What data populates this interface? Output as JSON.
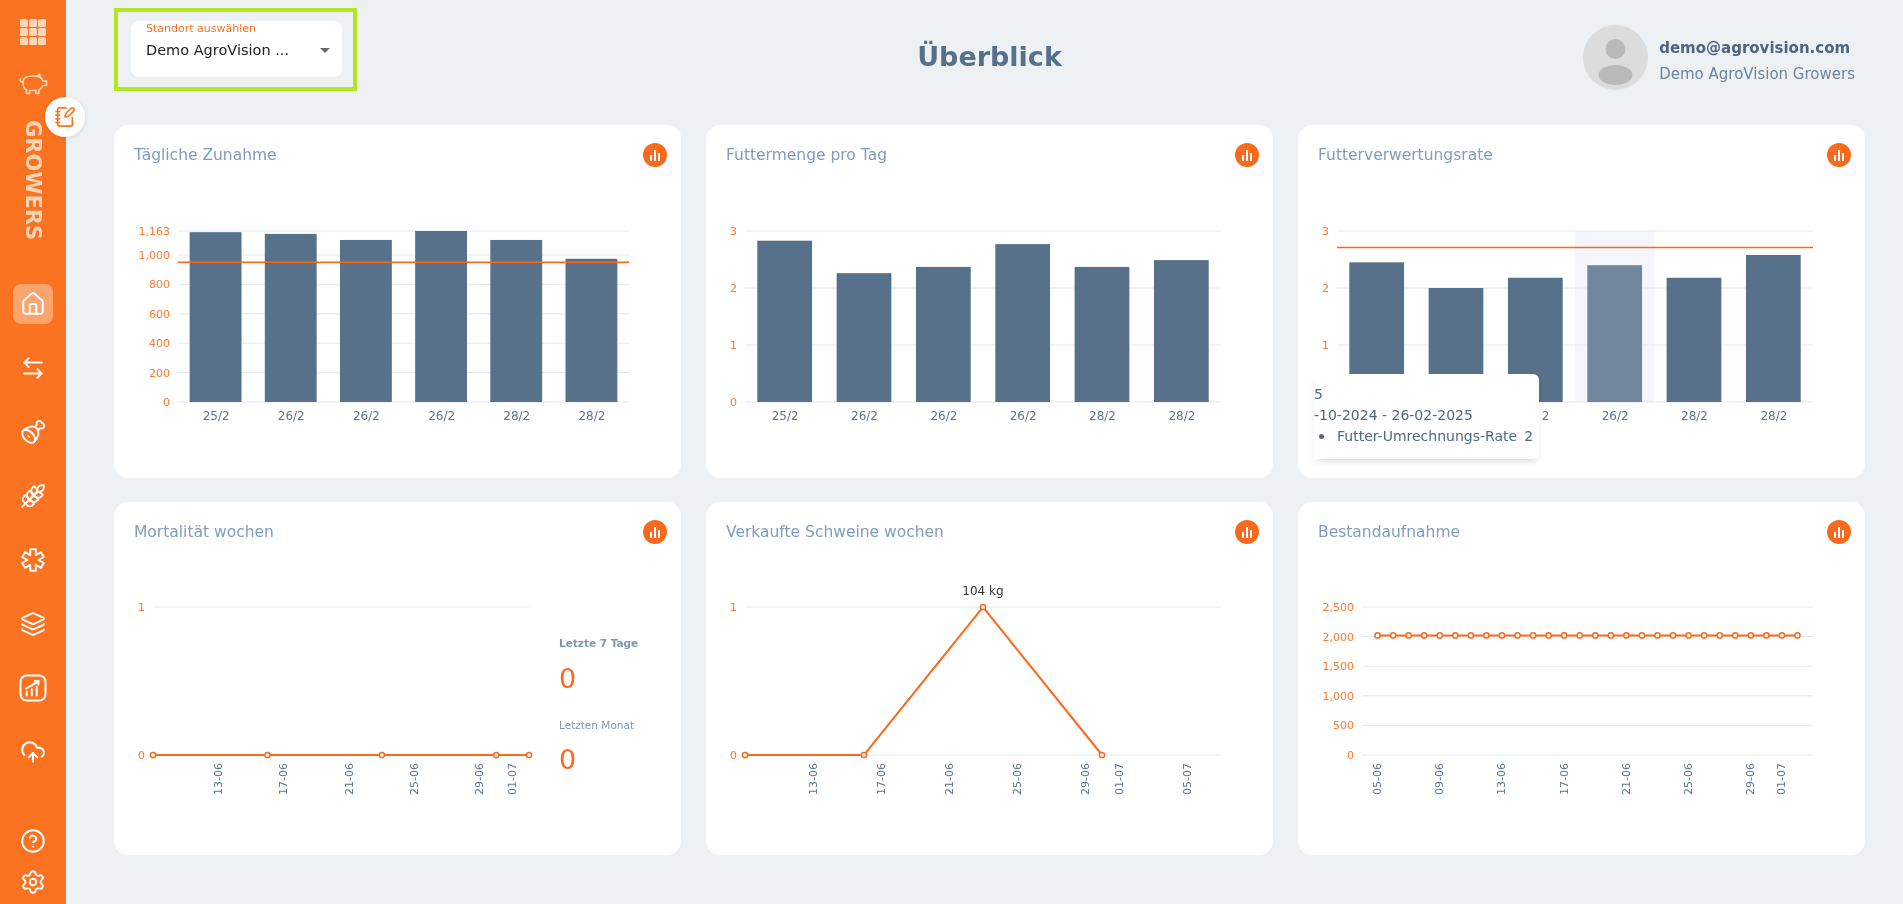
{
  "sidebar": {
    "brand": "GROWERS",
    "nav": [
      {
        "selected": true
      },
      {
        "selected": false
      },
      {
        "selected": false
      },
      {
        "selected": false
      },
      {
        "selected": false
      },
      {
        "selected": false
      },
      {
        "selected": false
      },
      {
        "selected": false
      }
    ]
  },
  "location_select": {
    "label": "Standort auswählen",
    "value": "Demo AgroVision ...",
    "highlighted": true
  },
  "title": "Überblick",
  "user": {
    "email": "demo@agrovision.com",
    "name": "Demo AgroVision Growers"
  },
  "cards": [
    {
      "title": "Tägliche Zunahme",
      "chart_data": {
        "type": "bar",
        "categories": [
          "25/2",
          "26/2",
          "26/2",
          "26/2",
          "28/2",
          "28/2"
        ],
        "series": [
          {
            "color": "#58718a",
            "values": [
              1155,
              1143,
              1102,
              1163,
              1102,
              974
            ]
          }
        ],
        "ylim": [
          0,
          1163
        ],
        "yticks": [
          0,
          200,
          400,
          600,
          800,
          {
            "value": 1000,
            "label": "1,000"
          },
          {
            "value": 1163,
            "label": "1,163"
          }
        ],
        "grid": true,
        "ref_lines": [
          {
            "axis": "y",
            "value": 951,
            "color": "#fb6a1c"
          }
        ]
      }
    },
    {
      "title": "Futtermenge pro Tag",
      "chart_data": {
        "type": "bar",
        "categories": [
          "25/2",
          "26/2",
          "26/2",
          "26/2",
          "28/2",
          "28/2"
        ],
        "series": [
          {
            "color": "#58718a",
            "values": [
              2.83,
              2.26,
              2.37,
              2.77,
              2.37,
              2.49
            ]
          }
        ],
        "ylim": [
          0,
          3
        ],
        "yticks": [
          0,
          1,
          2,
          3
        ],
        "grid": true
      }
    },
    {
      "title": "Futterverwertungsrate",
      "chart_data": {
        "type": "bar",
        "categories": [
          null,
          null,
          "2",
          "26/2",
          "28/2",
          "28/2"
        ],
        "series": [
          {
            "color": "#58718a",
            "values": [
              2.45,
              2.0,
              2.18,
              null,
              2.18,
              2.58
            ]
          },
          {
            "color": "#71879d",
            "values": [
              null,
              null,
              null,
              2.4,
              null,
              null
            ]
          }
        ],
        "stacked": true,
        "ylim": [
          0,
          3
        ],
        "yticks": [
          1,
          2,
          3
        ],
        "grid": true,
        "ref_lines": [
          {
            "axis": "y",
            "value": 2.71,
            "color": "#fb6a1c"
          }
        ]
      },
      "tooltip": {
        "title": "5",
        "range": "-10-2024 - 26-02-2025",
        "series": "Futter-Umrechnungs-Rate",
        "value": "2"
      }
    },
    {
      "title": "Mortalität wochen",
      "chart_data": {
        "type": "line",
        "categories": [
          null,
          null,
          null,
          null,
          "13-06",
          null,
          null,
          null,
          "17-06",
          null,
          null,
          null,
          "21-06",
          null,
          null,
          null,
          "25-06",
          null,
          null,
          null,
          "29-06",
          null,
          "01-07",
          null
        ],
        "series": [
          {
            "color": "#fb6a1c",
            "marker": "o",
            "values": [
              0,
              null,
              null,
              null,
              null,
              null,
              null,
              0,
              null,
              null,
              null,
              null,
              null,
              null,
              0,
              null,
              null,
              null,
              null,
              null,
              null,
              0,
              null,
              0
            ]
          }
        ],
        "ylim": [
          0,
          1
        ],
        "yticks": [
          0,
          1
        ],
        "grid": true
      },
      "stats": [
        {
          "label": "Letzte 7 Tage",
          "value": "0",
          "emphasized": true
        },
        {
          "label": "Letzten Monat",
          "value": "0",
          "emphasized": false
        }
      ]
    },
    {
      "title": "Verkaufte Schweine wochen",
      "chart_data": {
        "type": "line",
        "categories": [
          null,
          null,
          null,
          null,
          "13-06",
          null,
          null,
          null,
          "17-06",
          null,
          null,
          null,
          "21-06",
          null,
          null,
          null,
          "25-06",
          null,
          null,
          null,
          "29-06",
          null,
          "01-07",
          null,
          null,
          null,
          "05-07",
          null,
          null
        ],
        "series": [
          {
            "color": "#fb6a1c",
            "marker": "o",
            "values": [
              0,
              null,
              null,
              null,
              null,
              null,
              null,
              0,
              null,
              null,
              null,
              null,
              null,
              null,
              1,
              null,
              null,
              null,
              null,
              null,
              null,
              0,
              null,
              null,
              null,
              null,
              null,
              null,
              null
            ]
          }
        ],
        "ylim": [
          0,
          1
        ],
        "yticks": [
          0,
          1
        ],
        "grid": true,
        "value_labels": [
          null,
          null,
          null,
          null,
          null,
          null,
          null,
          null,
          null,
          null,
          null,
          null,
          null,
          null,
          "104 kg",
          null,
          null,
          null,
          null,
          null,
          null,
          null,
          null,
          null,
          null,
          null,
          null,
          null,
          null
        ]
      }
    },
    {
      "title": "Bestandaufnahme",
      "chart_data": {
        "type": "line",
        "categories": [
          null,
          "05-06",
          null,
          null,
          null,
          "09-06",
          null,
          null,
          null,
          "13-06",
          null,
          null,
          null,
          "17-06",
          null,
          null,
          null,
          "21-06",
          null,
          null,
          null,
          "25-06",
          null,
          null,
          null,
          "29-06",
          null,
          "01-07",
          null,
          null
        ],
        "series": [
          {
            "color": "#fb6a1c",
            "marker": "o",
            "values": [
              null,
              2020,
              2020,
              2020,
              2020,
              2020,
              2020,
              2020,
              2020,
              2020,
              2020,
              2020,
              2020,
              2020,
              2020,
              2020,
              2020,
              2020,
              2020,
              2020,
              2020,
              2020,
              2020,
              2020,
              2020,
              2020,
              2020,
              2020,
              2020,
              null
            ]
          }
        ],
        "ylim": [
          0,
          2500
        ],
        "yticks": [
          0,
          500,
          {
            "value": 1000,
            "label": "1,000"
          },
          {
            "value": 1500,
            "label": "1,500"
          },
          {
            "value": 2000,
            "label": "2,000"
          },
          {
            "value": 2500,
            "label": "2,500"
          }
        ],
        "grid": true
      }
    }
  ]
}
